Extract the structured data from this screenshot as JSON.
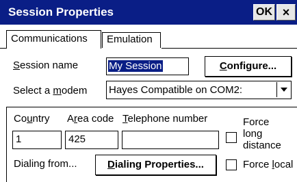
{
  "window": {
    "title": "Session Properties",
    "ok_label": "OK",
    "close_glyph": "×",
    "colors": {
      "titlebar": "#0a1e86",
      "selection": "#0a1e86"
    }
  },
  "tabs": [
    {
      "label": "Communications",
      "active": true
    },
    {
      "label": "Emulation",
      "active": false
    }
  ],
  "session": {
    "name_label_key": "S",
    "name_label_rest": "ession name",
    "name_value": "My Session",
    "configure_key": "C",
    "configure_rest": "onfigure..."
  },
  "modem": {
    "label_pre": "Select a ",
    "label_key": "m",
    "label_rest": "odem",
    "selected": "Hayes Compatible on COM2:"
  },
  "dialing": {
    "country_pre": "Co",
    "country_key": "u",
    "country_rest": "ntry",
    "country_value": "1",
    "area_pre": "A",
    "area_key": "r",
    "area_rest": "ea code",
    "area_value": "425",
    "phone_key": "T",
    "phone_rest": "elephone number",
    "phone_value": "",
    "dialing_from": "Dialing from...",
    "dialing_props_key": "D",
    "dialing_props_rest": "ialing Properties..."
  },
  "options": {
    "force_long_line1": "Force",
    "force_long_line2_pre": "lon",
    "force_long_line2_key": "g",
    "force_long_line3": "distance",
    "force_long_checked": false,
    "force_local_pre": "Force ",
    "force_local_key": "l",
    "force_local_rest": "ocal",
    "force_local_checked": false
  }
}
